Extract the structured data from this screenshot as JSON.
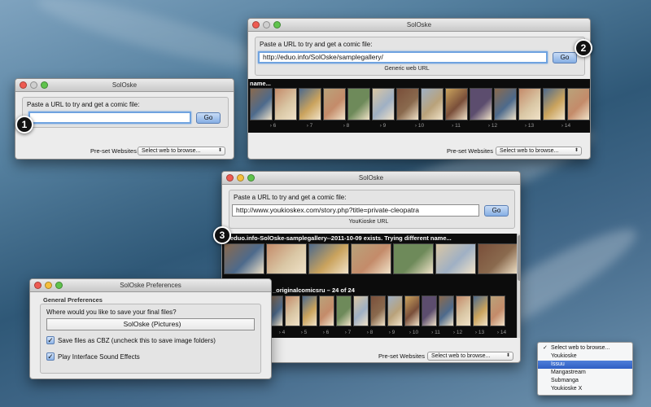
{
  "app_title": "SolOske",
  "shared": {
    "url_prompt": "Paste a URL to try and get a comic file:",
    "go_label": "Go",
    "preset_label": "Pre-set Websites",
    "select_placeholder": "Select web to browse..."
  },
  "window1": {
    "url_value": "",
    "badge": "1"
  },
  "window2": {
    "url_value": "http://eduo.info/SolOske/samplegallery/",
    "url_type": "Generic web URL",
    "badge": "2",
    "strip_label": "name...",
    "page_numbers": [
      "6",
      "7",
      "8",
      "9",
      "10",
      "11",
      "12",
      "13",
      "14"
    ]
  },
  "window3": {
    "url_value": "http://www.youkioskex.com/story.php?title=private-cleopatra",
    "url_type": "YouKioske URL",
    "badge": "3",
    "strip1_label": "eduo.info-SolOske-samplegallery--2011-10-09 exists. Trying different name...",
    "strip2_label": "_originalcomicsru – 24 of 24",
    "page_numbers": [
      "4",
      "5",
      "6",
      "7",
      "8",
      "9",
      "10",
      "11",
      "12",
      "13",
      "14"
    ]
  },
  "preferences": {
    "title": "SolOske Preferences",
    "section": "General Preferences",
    "save_question": "Where would you like to save your final files?",
    "save_location": "SolOske (Pictures)",
    "option_cbz": "Save files as CBZ (uncheck this to save image folders)",
    "option_sound": "Play Interface Sound Effects",
    "cbz_checked": true,
    "sound_checked": true
  },
  "dropdown": {
    "items": [
      "Select web to browse...",
      "Youkioske",
      "Issuu",
      "Mangastream",
      "Submanga",
      "Youkioske X"
    ],
    "checked_index": 0,
    "highlighted_index": 2
  },
  "colors": {
    "accent": "#3b6fd1",
    "go_button": "#8fb4e6",
    "strip_bg": "#0c0c0c"
  }
}
